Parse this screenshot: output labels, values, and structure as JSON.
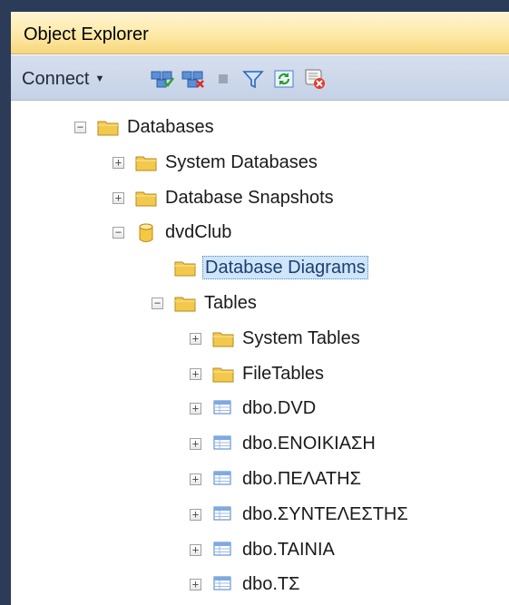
{
  "panel": {
    "title": "Object Explorer"
  },
  "toolbar": {
    "connect_label": "Connect",
    "icons": [
      "connect-object-explorer-icon",
      "disconnect-icon",
      "stop-icon",
      "filter-icon",
      "refresh-icon",
      "script-cancel-icon"
    ]
  },
  "tree": {
    "items": [
      {
        "label": "Databases",
        "icon": "folder-icon",
        "expander": "minus",
        "level": 0
      },
      {
        "label": "System Databases",
        "icon": "folder-icon",
        "expander": "plus",
        "level": 1
      },
      {
        "label": "Database Snapshots",
        "icon": "folder-icon",
        "expander": "plus",
        "level": 1
      },
      {
        "label": "dvdClub",
        "icon": "database-icon",
        "expander": "minus",
        "level": 1
      },
      {
        "label": "Database Diagrams",
        "icon": "folder-icon",
        "expander": "none",
        "level": 2,
        "selected": true
      },
      {
        "label": "Tables",
        "icon": "folder-icon",
        "expander": "minus",
        "level": 2
      },
      {
        "label": "System Tables",
        "icon": "folder-icon",
        "expander": "plus",
        "level": 3
      },
      {
        "label": "FileTables",
        "icon": "folder-icon",
        "expander": "plus",
        "level": 3
      },
      {
        "label": "dbo.DVD",
        "icon": "table-icon",
        "expander": "plus",
        "level": 3
      },
      {
        "label": "dbo.ΕΝΟΙΚΙΑΣΗ",
        "icon": "table-icon",
        "expander": "plus",
        "level": 3
      },
      {
        "label": "dbo.ΠΕΛΑΤΗΣ",
        "icon": "table-icon",
        "expander": "plus",
        "level": 3
      },
      {
        "label": "dbo.ΣΥΝΤΕΛΕΣΤΗΣ",
        "icon": "table-icon",
        "expander": "plus",
        "level": 3
      },
      {
        "label": "dbo.ΤΑΙΝΙΑ",
        "icon": "table-icon",
        "expander": "plus",
        "level": 3
      },
      {
        "label": "dbo.ΤΣ",
        "icon": "table-icon",
        "expander": "plus",
        "level": 3
      }
    ]
  },
  "colors": {
    "frame": "#2b3b58",
    "title_bar": "#fde9a6",
    "toolbar": "#c9d5e8",
    "selection": "#cfe5fa",
    "folder": "#f2c94c"
  }
}
